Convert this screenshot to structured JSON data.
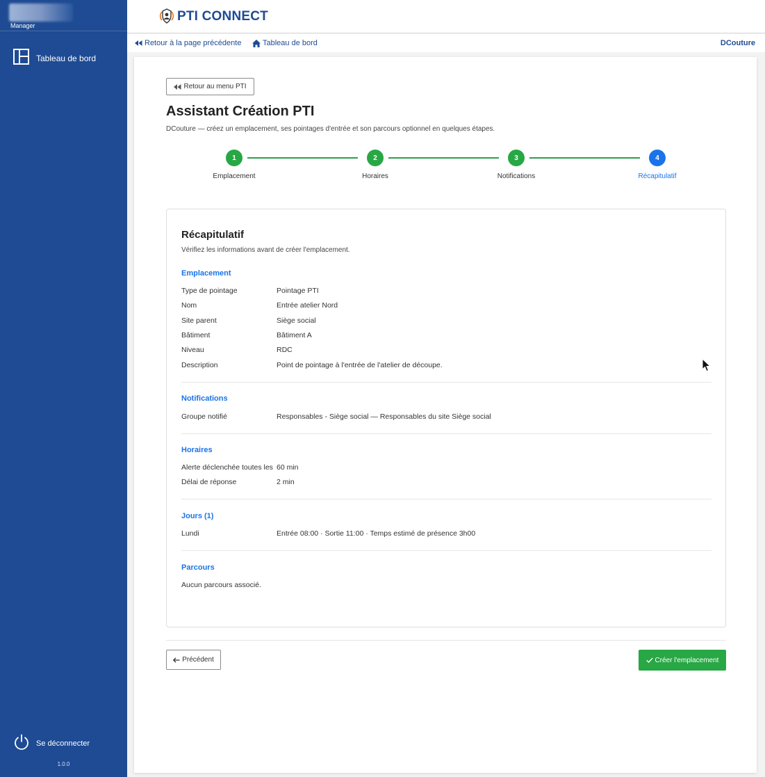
{
  "sidebar": {
    "role": "Manager",
    "items": [
      {
        "label": "Tableau de bord",
        "icon": "dashboard-icon"
      }
    ],
    "logout_label": "Se déconnecter",
    "version": "1.0.0"
  },
  "header": {
    "brand": "PTI CONNECT"
  },
  "navbar": {
    "back_label": "Retour à la page précédente",
    "dashboard_label": "Tableau de bord",
    "user": "DCouture"
  },
  "main": {
    "back_menu_label": "Retour au menu PTI",
    "title": "Assistant Création PTI",
    "subtitle": "DCouture — créez un emplacement, ses pointages d'entrée et son parcours optionnel en quelques étapes."
  },
  "stepper": {
    "steps": [
      {
        "number": "1",
        "label": "Emplacement",
        "status": "done"
      },
      {
        "number": "2",
        "label": "Horaires",
        "status": "done"
      },
      {
        "number": "3",
        "label": "Notifications",
        "status": "done"
      },
      {
        "number": "4",
        "label": "Récapitulatif",
        "status": "active"
      }
    ],
    "done_color": "#28a745",
    "active_color": "#1a73e8"
  },
  "summary": {
    "title": "Récapitulatif",
    "subtitle": "Vérifiez les informations avant de créer l'emplacement.",
    "emplacement": {
      "title": "Emplacement",
      "rows": [
        {
          "k": "Type de pointage",
          "v": "Pointage PTI"
        },
        {
          "k": "Nom",
          "v": "Entrée atelier Nord"
        },
        {
          "k": "Site parent",
          "v": "Siège social"
        },
        {
          "k": "Bâtiment",
          "v": "Bâtiment A"
        },
        {
          "k": "Niveau",
          "v": "RDC"
        },
        {
          "k": "Description",
          "v": "Point de pointage à l'entrée de l'atelier de découpe."
        }
      ]
    },
    "notifications": {
      "title": "Notifications",
      "rows": [
        {
          "k": "Groupe notifié",
          "v": "Responsables - Siège social — Responsables du site Siège social"
        }
      ]
    },
    "horaires": {
      "title": "Horaires",
      "rows": [
        {
          "k": "Alerte déclenchée toutes les",
          "v": "60 min"
        },
        {
          "k": "Délai de réponse",
          "v": "2 min"
        }
      ]
    },
    "jours": {
      "title": "Jours (1)",
      "rows": [
        {
          "k": "Lundi",
          "v": "Entrée 08:00 · Sortie 11:00 · Temps estimé de présence 3h00"
        }
      ]
    },
    "parcours": {
      "title": "Parcours",
      "text": "Aucun parcours associé."
    }
  },
  "actions": {
    "prev_label": "Précédent",
    "create_label": "Créer l'emplacement"
  },
  "colors": {
    "sidebar": "#1e4b93",
    "accent": "#1a73e8",
    "success": "#28a745"
  }
}
